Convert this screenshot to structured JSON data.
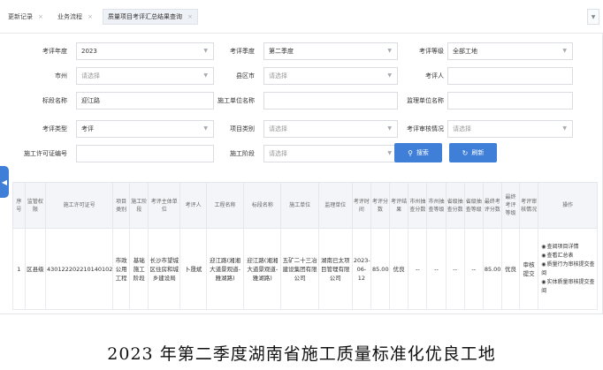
{
  "tabs": [
    {
      "label": "更新记录",
      "active": false
    },
    {
      "label": "业务流程",
      "active": false
    },
    {
      "label": "质量项目考评汇总结果查询",
      "active": true
    }
  ],
  "close_glyph": "×",
  "form": {
    "eval_year": {
      "label": "考评年度",
      "value": "2023"
    },
    "eval_quarter": {
      "label": "考评季度",
      "value": "第二季度"
    },
    "eval_level": {
      "label": "考评等级",
      "value": "全部工地"
    },
    "city": {
      "label": "市州",
      "placeholder": "请选择"
    },
    "county": {
      "label": "县区市",
      "placeholder": "请选择"
    },
    "evaluator": {
      "label": "考评人",
      "value": ""
    },
    "section_name": {
      "label": "标段名称",
      "value": "迎江路"
    },
    "contractor": {
      "label": "施工单位名称",
      "value": ""
    },
    "supervisor": {
      "label": "监理单位名称",
      "value": ""
    },
    "eval_type": {
      "label": "考评类型",
      "value": "考评"
    },
    "project_category": {
      "label": "项目类别",
      "placeholder": "请选择"
    },
    "review_status": {
      "label": "考评审核情况",
      "placeholder": "请选择"
    },
    "permit_no": {
      "label": "施工许可证编号",
      "value": ""
    },
    "stage": {
      "label": "施工阶段",
      "placeholder": "请选择"
    }
  },
  "buttons": {
    "search": "搜索",
    "refresh": "刷新"
  },
  "icons": {
    "search": "search-icon",
    "refresh": "refresh-icon",
    "dropdown": "chevron-down-icon",
    "collapse": "chevron-left-icon"
  },
  "table": {
    "headers": [
      "序号",
      "监管权限",
      "施工许可证号",
      "项目类别",
      "施工阶段",
      "考评主体单位",
      "考评人",
      "工程名称",
      "标段名称",
      "施工单位",
      "监理单位",
      "考评时间",
      "考评分数",
      "考评结果",
      "市州抽查分数",
      "市州抽查等级",
      "省级抽查分数",
      "省级抽查等级",
      "最终考评分数",
      "最终考评等级",
      "考评审核情况",
      "操作"
    ],
    "rows": [
      {
        "index": "1",
        "authority": "区县级",
        "permit": "430122202210140102",
        "category": "市政公用工程",
        "stage": "基础施工阶段",
        "eval_unit": "长沙市望城区住房和城乡建设局",
        "evaluator": "卜晟斌",
        "project": "迎江路(湘湘大道景观道-雅湖路)",
        "section": "迎江路(湘湘大道景观道-雅湖路)",
        "contractor": "五矿二十三冶建设集团有限公司",
        "supervisor": "湖南已太项目管理有限公司",
        "eval_time": "2023-06-12",
        "score": "85.00",
        "result": "优良",
        "city_score": "--",
        "city_level": "--",
        "prov_score": "--",
        "prov_level": "--",
        "final_score": "85.00",
        "final_level": "优良",
        "review": "审核提交",
        "ops": [
          "查阅项目详情",
          "查看汇总表",
          "质量行为审核提交查阅",
          "实体质量审核提交查阅"
        ]
      }
    ]
  },
  "caption": "2023 年第二季度湖南省施工质量标准化优良工地",
  "colors": {
    "primary": "#3f7fd8",
    "danger": "#e03131",
    "header_bg": "#f3f5f8"
  }
}
